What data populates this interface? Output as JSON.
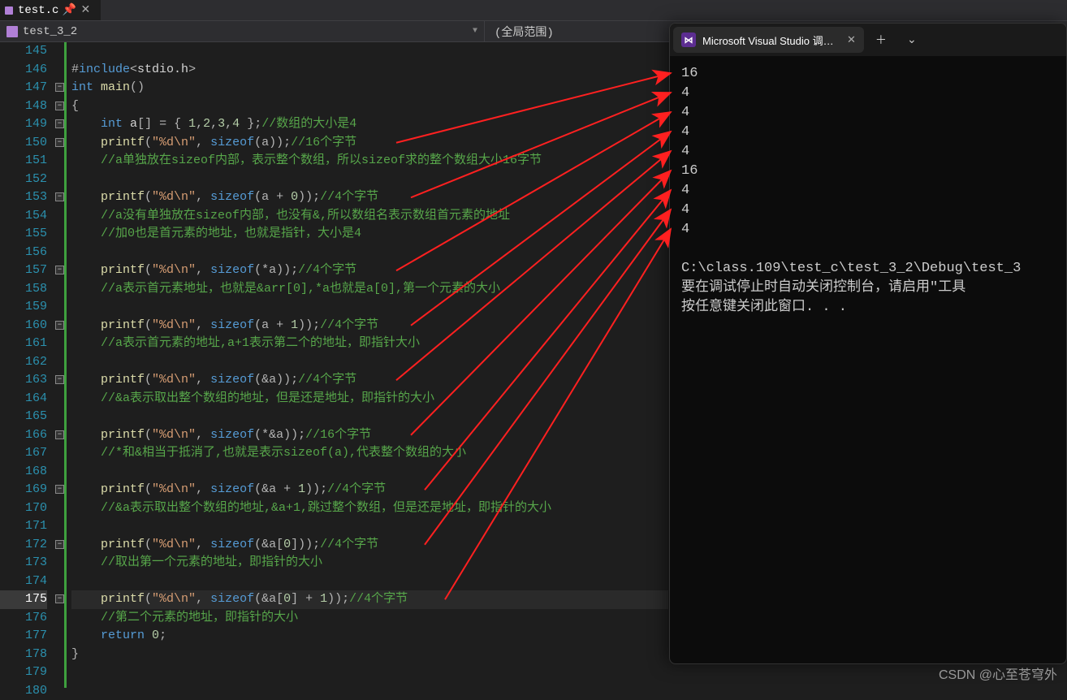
{
  "tabs": {
    "file": "test.c"
  },
  "scope": {
    "module": "test_3_2",
    "right": "(全局范围)"
  },
  "lineStart": 145,
  "lineEnd": 180,
  "highlightLine": 175,
  "foldLines": [
    147,
    148,
    149,
    150,
    153,
    157,
    160,
    163,
    166,
    169,
    172,
    175
  ],
  "code": [
    {
      "n": 145,
      "h": ""
    },
    {
      "n": 146,
      "h": "<span class='op'>#</span><span class='kw'>include</span><span class='op'>&lt;</span><span class='pl'>stdio.h</span><span class='op'>&gt;</span>"
    },
    {
      "n": 147,
      "h": "<span class='kw'>int</span> <span class='fn'>main</span><span class='op'>()</span>"
    },
    {
      "n": 148,
      "h": "<span class='op'>{</span>"
    },
    {
      "n": 149,
      "h": "    <span class='kw'>int</span> <span class='pl'>a</span><span class='op'>[] = { </span><span class='num'>1</span><span class='op'>,</span><span class='num'>2</span><span class='op'>,</span><span class='num'>3</span><span class='op'>,</span><span class='num'>4</span><span class='op'> };</span><span class='cm'>//数组的大小是4</span>"
    },
    {
      "n": 150,
      "h": "    <span class='fn'>printf</span><span class='op'>(</span><span class='str'>\"%d\\n\"</span><span class='op'>, </span><span class='kw'>sizeof</span><span class='op'>(a));</span><span class='cm'>//16个字节</span>"
    },
    {
      "n": 151,
      "h": "    <span class='cm'>//a单独放在sizeof内部，表示整个数组，所以sizeof求的整个数组大小16字节</span>"
    },
    {
      "n": 152,
      "h": ""
    },
    {
      "n": 153,
      "h": "    <span class='fn'>printf</span><span class='op'>(</span><span class='str'>\"%d\\n\"</span><span class='op'>, </span><span class='kw'>sizeof</span><span class='op'>(a + </span><span class='num'>0</span><span class='op'>));</span><span class='cm'>//4个字节</span>"
    },
    {
      "n": 154,
      "h": "    <span class='cm'>//a没有单独放在sizeof内部，也没有&,所以数组名表示数组首元素的地址</span>"
    },
    {
      "n": 155,
      "h": "    <span class='cm'>//加0也是首元素的地址，也就是指针，大小是4</span>"
    },
    {
      "n": 156,
      "h": ""
    },
    {
      "n": 157,
      "h": "    <span class='fn'>printf</span><span class='op'>(</span><span class='str'>\"%d\\n\"</span><span class='op'>, </span><span class='kw'>sizeof</span><span class='op'>(*a));</span><span class='cm'>//4个字节</span>"
    },
    {
      "n": 158,
      "h": "    <span class='cm'>//a表示首元素地址，也就是&arr[0],*a也就是a[0],第一个元素的大小</span>"
    },
    {
      "n": 159,
      "h": ""
    },
    {
      "n": 160,
      "h": "    <span class='fn'>printf</span><span class='op'>(</span><span class='str'>\"%d\\n\"</span><span class='op'>, </span><span class='kw'>sizeof</span><span class='op'>(a + </span><span class='num'>1</span><span class='op'>));</span><span class='cm'>//4个字节</span>"
    },
    {
      "n": 161,
      "h": "    <span class='cm'>//a表示首元素的地址,a+1表示第二个的地址，即指针大小</span>"
    },
    {
      "n": 162,
      "h": ""
    },
    {
      "n": 163,
      "h": "    <span class='fn'>printf</span><span class='op'>(</span><span class='str'>\"%d\\n\"</span><span class='op'>, </span><span class='kw'>sizeof</span><span class='op'>(&amp;a));</span><span class='cm'>//4个字节</span>"
    },
    {
      "n": 164,
      "h": "    <span class='cm'>//&a表示取出整个数组的地址，但是还是地址，即指针的大小</span>"
    },
    {
      "n": 165,
      "h": ""
    },
    {
      "n": 166,
      "h": "    <span class='fn'>printf</span><span class='op'>(</span><span class='str'>\"%d\\n\"</span><span class='op'>, </span><span class='kw'>sizeof</span><span class='op'>(*&amp;a));</span><span class='cm'>//16个字节</span>"
    },
    {
      "n": 167,
      "h": "    <span class='cm'>//*和&相当于抵消了,也就是表示sizeof(a),代表整个数组的大小</span>"
    },
    {
      "n": 168,
      "h": ""
    },
    {
      "n": 169,
      "h": "    <span class='fn'>printf</span><span class='op'>(</span><span class='str'>\"%d\\n\"</span><span class='op'>, </span><span class='kw'>sizeof</span><span class='op'>(&amp;a + </span><span class='num'>1</span><span class='op'>));</span><span class='cm'>//4个字节</span>"
    },
    {
      "n": 170,
      "h": "    <span class='cm'>//&a表示取出整个数组的地址,&a+1,跳过整个数组，但是还是地址，即指针的大小</span>"
    },
    {
      "n": 171,
      "h": ""
    },
    {
      "n": 172,
      "h": "    <span class='fn'>printf</span><span class='op'>(</span><span class='str'>\"%d\\n\"</span><span class='op'>, </span><span class='kw'>sizeof</span><span class='op'>(&amp;a[</span><span class='num'>0</span><span class='op'>]));</span><span class='cm'>//4个字节</span>"
    },
    {
      "n": 173,
      "h": "    <span class='cm'>//取出第一个元素的地址，即指针的大小</span>"
    },
    {
      "n": 174,
      "h": ""
    },
    {
      "n": 175,
      "h": "    <span class='fn'>printf</span><span class='op'>(</span><span class='str'>\"%d\\n\"</span><span class='op'>, </span><span class='kw'>sizeof</span><span class='op'>(&amp;a[</span><span class='num'>0</span><span class='op'>] + </span><span class='num'>1</span><span class='op'>));</span><span class='cm'>//4个字节</span>"
    },
    {
      "n": 176,
      "h": "    <span class='cm'>//第二个元素的地址，即指针的大小</span>"
    },
    {
      "n": 177,
      "h": "    <span class='kw'>return</span> <span class='num'>0</span><span class='op'>;</span>"
    },
    {
      "n": 178,
      "h": "<span class='op'>}</span>"
    },
    {
      "n": 179,
      "h": ""
    },
    {
      "n": 180,
      "h": ""
    }
  ],
  "console": {
    "title": "Microsoft Visual Studio 调试控",
    "output": [
      "16",
      "4",
      "4",
      "4",
      "4",
      "16",
      "4",
      "4",
      "4"
    ],
    "path": "C:\\class.109\\test_c\\test_3_2\\Debug\\test_3",
    "msg1": "要在调试停止时自动关闭控制台，请启用\"工具",
    "msg2": "按任意键关闭此窗口. . ."
  },
  "arrows": [
    {
      "srcLine": 150,
      "srcX": 400,
      "dst": 0
    },
    {
      "srcLine": 153,
      "srcX": 418,
      "dst": 1
    },
    {
      "srcLine": 157,
      "srcX": 400,
      "dst": 2
    },
    {
      "srcLine": 160,
      "srcX": 418,
      "dst": 3
    },
    {
      "srcLine": 163,
      "srcX": 400,
      "dst": 4
    },
    {
      "srcLine": 166,
      "srcX": 418,
      "dst": 5
    },
    {
      "srcLine": 169,
      "srcX": 435,
      "dst": 6
    },
    {
      "srcLine": 172,
      "srcX": 435,
      "dst": 7
    },
    {
      "srcLine": 175,
      "srcX": 460,
      "dst": 8
    }
  ],
  "watermark": "CSDN @心至苍穹外"
}
